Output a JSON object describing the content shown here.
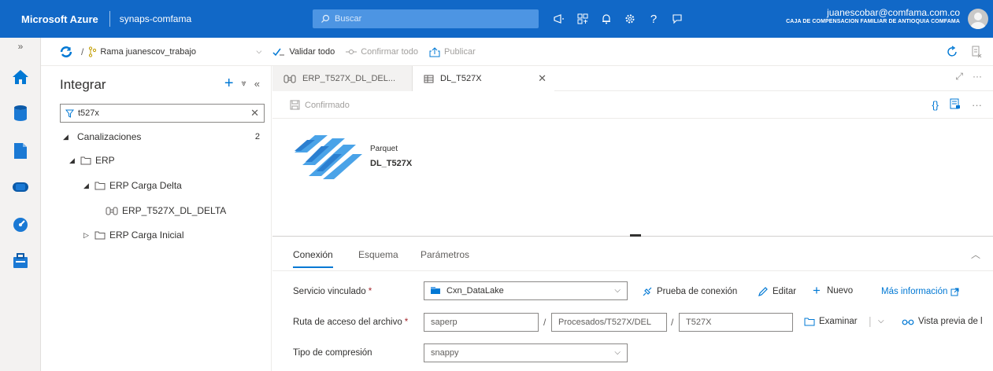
{
  "header": {
    "brand": "Microsoft Azure",
    "workspace": "synaps-comfama",
    "search_placeholder": "Buscar",
    "user_email": "juanescobar@comfama.com.co",
    "user_org": "CAJA DE COMPENSACION FAMILIAR DE ANTIOQUIA COMFAMA"
  },
  "toolbar": {
    "branch": "Rama juanescov_trabajo",
    "validate_all": "Validar todo",
    "confirm_all": "Confirmar todo",
    "publish": "Publicar"
  },
  "explorer": {
    "title": "Integrar",
    "filter_value": "t527x",
    "tree": {
      "pipelines_label": "Canalizaciones",
      "pipelines_count": "2",
      "erp": "ERP",
      "erp_delta": "ERP Carga Delta",
      "pipeline_item": "ERP_T527X_DL_DELTA",
      "erp_initial": "ERP Carga Inicial"
    }
  },
  "tabs": {
    "tab1": "ERP_T527X_DL_DEL...",
    "tab2": "DL_T527X"
  },
  "editor": {
    "status": "Confirmado",
    "dataset_type": "Parquet",
    "dataset_name": "DL_T527X"
  },
  "properties": {
    "tabs": [
      "Conexión",
      "Esquema",
      "Parámetros"
    ],
    "linked_service_label": "Servicio vinculado",
    "linked_service_value": "Cxn_DataLake",
    "test_connection": "Prueba de conexión",
    "edit": "Editar",
    "new": "Nuevo",
    "more_info": "Más información",
    "file_path_label": "Ruta de acceso del archivo",
    "path_container": "saperp",
    "path_directory": "Procesados/T527X/DEL",
    "path_file": "T527X",
    "browse": "Examinar",
    "preview": "Vista previa de l",
    "compression_label": "Tipo de compresión",
    "compression_value": "snappy",
    "required_mark": "*"
  },
  "colors": {
    "topbar": "#1168c7",
    "accent": "#0078d4"
  }
}
